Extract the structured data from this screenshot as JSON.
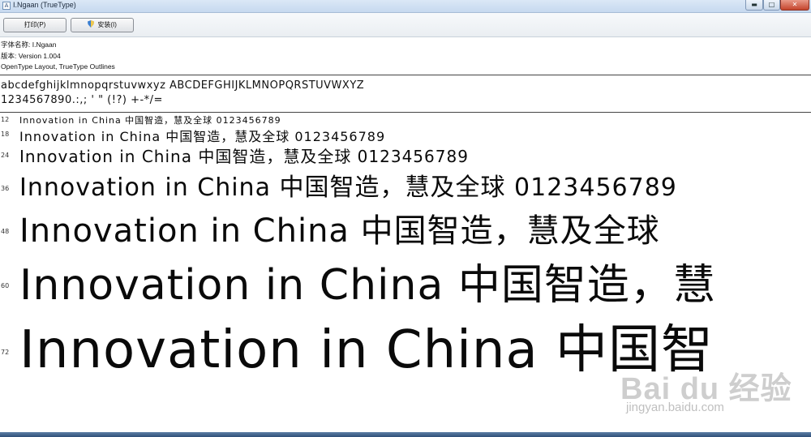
{
  "window": {
    "title": "I.Ngaan (TrueType)",
    "icon": "font-file-icon",
    "minimize": "minimize-icon",
    "maximize": "maximize-icon",
    "close": "close-icon"
  },
  "toolbar": {
    "print_label": "打印(P)",
    "install_label": "安装(I)",
    "install_icon": "shield-icon"
  },
  "info": {
    "font_name": "字体名称: I.Ngaan",
    "version": "版本: Version 1.004",
    "outlines": "OpenType Layout, TrueType Outlines"
  },
  "charset": {
    "letters": "abcdefghijklmnopqrstuvwxyz ABCDEFGHIJKLMNOPQRSTUVWXYZ",
    "digits": "1234567890.:,; ' \" (!?) +-*/="
  },
  "samples": [
    {
      "size": "12",
      "text": "Innovation in China 中国智造，慧及全球 0123456789"
    },
    {
      "size": "18",
      "text": "Innovation in China 中国智造，慧及全球 0123456789"
    },
    {
      "size": "24",
      "text": "Innovation in China 中国智造，慧及全球 0123456789"
    },
    {
      "size": "36",
      "text": "Innovation in China 中国智造，慧及全球 0123456789"
    },
    {
      "size": "48",
      "text": "Innovation in China 中国智造，慧及全球"
    },
    {
      "size": "60",
      "text": "Innovation in China 中国智造，慧"
    },
    {
      "size": "72",
      "text": "Innovation in China 中国智"
    }
  ],
  "watermark": {
    "logo": "Bai du 经验",
    "url": "jingyan.baidu.com"
  }
}
